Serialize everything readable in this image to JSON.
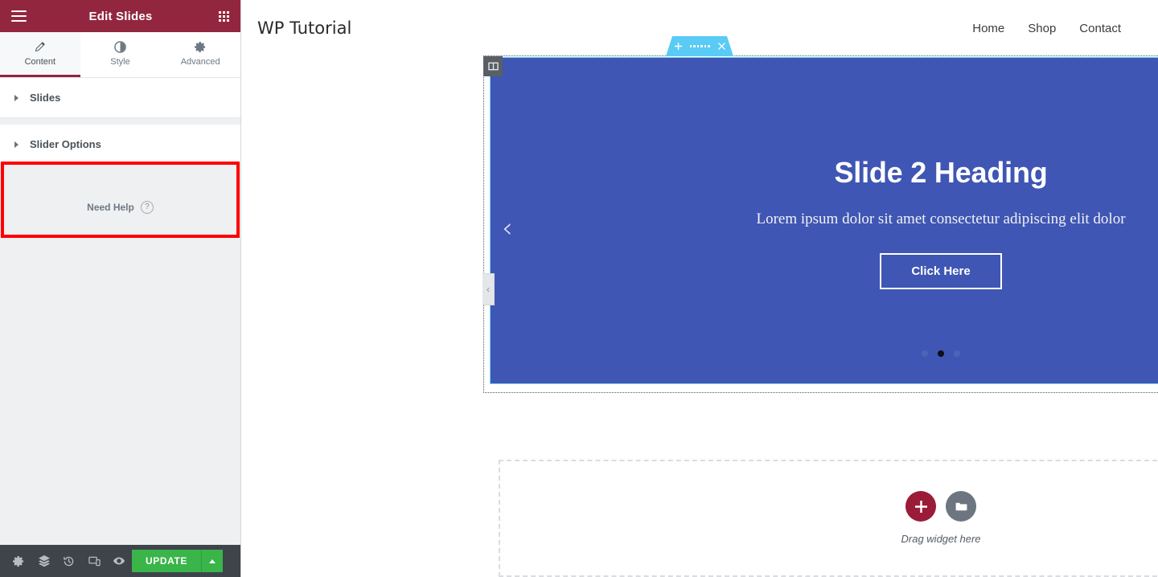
{
  "panel": {
    "header": {
      "title": "Edit Slides",
      "menu_icon": "hamburger-icon",
      "apps_icon": "grid-apps-icon"
    },
    "tabs": [
      {
        "label": "Content",
        "icon": "pencil-icon",
        "active": true
      },
      {
        "label": "Style",
        "icon": "half-circle-contrast-icon",
        "active": false
      },
      {
        "label": "Advanced",
        "icon": "gear-icon",
        "active": false
      }
    ],
    "sections": [
      {
        "label": "Slides",
        "expanded": false
      },
      {
        "label": "Slider Options",
        "expanded": false
      }
    ],
    "highlight_color": "#ff0000",
    "need_help": {
      "label": "Need Help",
      "icon": "question-circle-icon"
    },
    "footer": {
      "icons": [
        {
          "name": "settings-gear-icon"
        },
        {
          "name": "navigator-layers-icon"
        },
        {
          "name": "history-revisions-icon"
        },
        {
          "name": "responsive-mode-icon"
        },
        {
          "name": "preview-eye-icon"
        }
      ],
      "update_label": "UPDATE",
      "update_color": "#39b54a",
      "caret_icon": "caret-up-icon"
    }
  },
  "canvas": {
    "site": {
      "logo": "WP Tutorial",
      "nav": [
        "Home",
        "Shop",
        "Contact"
      ]
    },
    "section_toolbar": {
      "add_icon": "plus-icon",
      "drag_icon": "drag-handle-dots-icon",
      "close_icon": "close-x-icon",
      "color": "#59cbf5"
    },
    "column_button_icon": "column-layout-icon",
    "edit_handle_icon": "pencil-edit-icon",
    "collapse_handle_icon": "chevron-left-icon",
    "slider": {
      "background_color": "#3f56b4",
      "heading": "Slide 2 Heading",
      "description": "Lorem ipsum dolor sit amet consectetur adipiscing elit dolor",
      "button_label": "Click Here",
      "prev_icon": "chevron-left-icon",
      "next_icon": "chevron-right-icon",
      "dots": {
        "count": 3,
        "active_index": 1
      }
    },
    "drop_area": {
      "label": "Drag widget here",
      "add_icon": "plus-icon",
      "template_icon": "folder-template-icon"
    }
  }
}
